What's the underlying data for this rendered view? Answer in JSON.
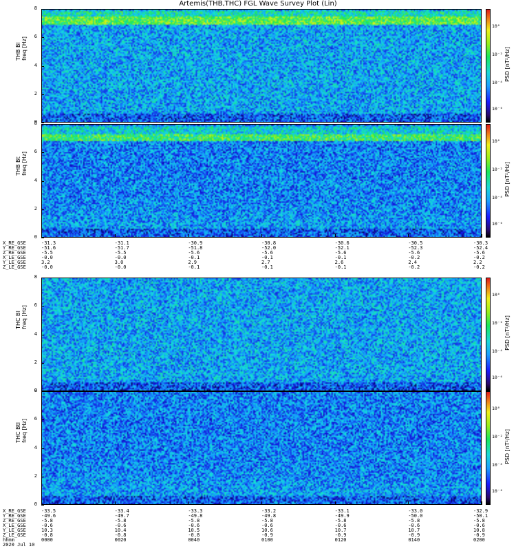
{
  "chart_data": {
    "type": "heatmap",
    "title": "Artemis(THB,THC) FGL Wave Survey Plot (Lin)",
    "panels": [
      {
        "name": "THB Bl",
        "ylabel": "freq [Hz]",
        "cbar_label": "PSD [nT²/Hz]",
        "ylim": [
          0,
          8
        ],
        "yticks": [
          "0",
          "2",
          "4",
          "6",
          "8"
        ],
        "cbar_ticks": [
          "10⁰",
          "10⁻²",
          "10⁻⁴",
          "10⁻⁶"
        ],
        "bright_band_hz": [
          7.0,
          7.6
        ]
      },
      {
        "name": "THB Bt",
        "ylabel": "freq [Hz]",
        "cbar_label": "PSD [nT²/Hz]",
        "ylim": [
          0,
          8
        ],
        "yticks": [
          "0",
          "2",
          "4",
          "6",
          "8"
        ],
        "cbar_ticks": [
          "10⁰",
          "10⁻²",
          "10⁻⁴",
          "10⁻⁶"
        ],
        "bright_band_hz": [
          6.9,
          7.4
        ]
      },
      {
        "name": "THC Bl",
        "ylabel": "freq [Hz]",
        "cbar_label": "PSD [nT²/Hz]",
        "ylim": [
          0,
          8
        ],
        "yticks": [
          "0",
          "2",
          "4",
          "6",
          "8"
        ],
        "cbar_ticks": [
          "10⁰",
          "10⁻²",
          "10⁻⁴",
          "10⁻⁶"
        ],
        "bright_band_hz": null
      },
      {
        "name": "THC Btl",
        "ylabel": "freq [Hz]",
        "cbar_label": "PSD [nT²/Hz]",
        "ylim": [
          0,
          8
        ],
        "yticks": [
          "0",
          "2",
          "4",
          "6",
          "8"
        ],
        "cbar_ticks": [
          "10⁰",
          "10⁻²",
          "10⁻⁴",
          "10⁻⁶"
        ],
        "bright_band_hz": null
      }
    ],
    "ephem_block_1": [
      {
        "label": "X_RE_GSE",
        "values": [
          "-31.3",
          "-31.1",
          "-30.9",
          "-30.8",
          "-30.6",
          "-30.5",
          "-30.3"
        ]
      },
      {
        "label": "Y_RE_GSE",
        "values": [
          "-51.6",
          "-51.7",
          "-51.8",
          "-52.0",
          "-52.1",
          "-52.3",
          "-52.4"
        ]
      },
      {
        "label": "Z_RE_GSE",
        "values": [
          "-5.5",
          "-5.5",
          "-5.6",
          "-5.6",
          "-5.6",
          "-5.6",
          "-5.6"
        ]
      },
      {
        "label": "X_LE_GSE",
        "values": [
          "-0.0",
          "-0.0",
          "-0.1",
          "-0.1",
          "-0.1",
          "-0.2",
          "-0.2"
        ]
      },
      {
        "label": "Y_LE_GSE",
        "values": [
          "3.2",
          "3.0",
          "2.9",
          "2.7",
          "2.6",
          "2.4",
          "2.2"
        ]
      },
      {
        "label": "Z_LE_GSE",
        "values": [
          "-0.0",
          "-0.0",
          "-0.1",
          "-0.1",
          "-0.1",
          "-0.2",
          "-0.2"
        ]
      }
    ],
    "ephem_block_2": [
      {
        "label": "X_RE_GSE",
        "values": [
          "-33.5",
          "-33.4",
          "-33.3",
          "-33.2",
          "-33.1",
          "-33.0",
          "-32.9"
        ]
      },
      {
        "label": "Y_RE_GSE",
        "values": [
          "-49.6",
          "-49.7",
          "-49.8",
          "-49.8",
          "-49.9",
          "-50.0",
          "-50.1"
        ]
      },
      {
        "label": "Z_RE_GSE",
        "values": [
          "-5.8",
          "-5.8",
          "-5.8",
          "-5.8",
          "-5.8",
          "-5.8",
          "-5.8"
        ]
      },
      {
        "label": "X_LE_GSE",
        "values": [
          "-0.6",
          "-0.6",
          "-0.6",
          "-0.6",
          "-0.6",
          "-0.6",
          "-0.6"
        ]
      },
      {
        "label": "Y_LE_GSE",
        "values": [
          "10.3",
          "10.4",
          "10.5",
          "10.6",
          "10.7",
          "10.7",
          "10.8"
        ]
      },
      {
        "label": "Z_LE_GSE",
        "values": [
          "-0.8",
          "-0.8",
          "-0.8",
          "-0.9",
          "-0.9",
          "-0.9",
          "-0.9"
        ]
      },
      {
        "label": "hhmm",
        "values": [
          "0000",
          "0020",
          "0040",
          "0100",
          "0120",
          "0140",
          "0200"
        ]
      },
      {
        "label": "2020 Jul 10",
        "values": [
          "",
          "",
          "",
          "",
          "",
          "",
          ""
        ]
      }
    ],
    "x_time_ticks": [
      "0000",
      "0020",
      "0040",
      "0100",
      "0120",
      "0140",
      "0200"
    ],
    "date": "2020 Jul 10"
  }
}
